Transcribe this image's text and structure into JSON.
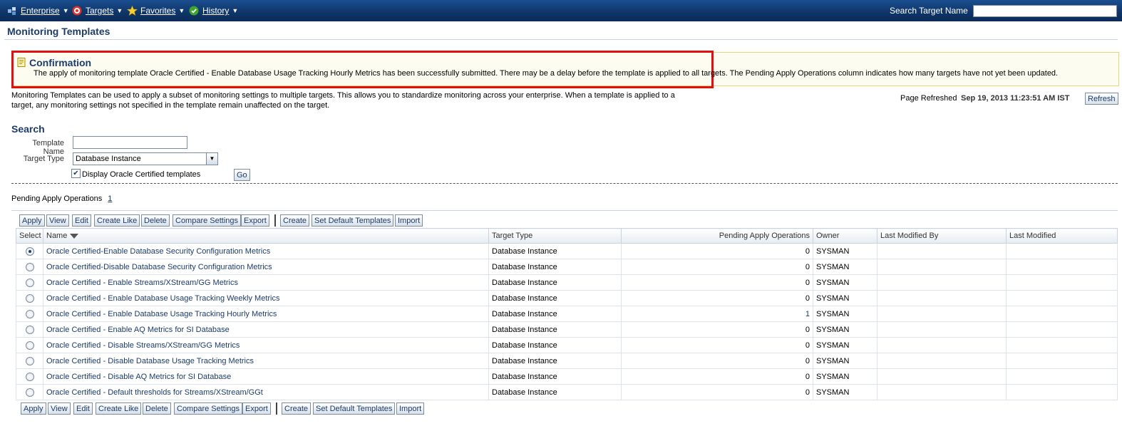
{
  "nav": {
    "enterprise": "Enterprise",
    "targets": "Targets",
    "favorites": "Favorites",
    "history": "History",
    "search_label": "Search Target Name"
  },
  "page": {
    "title": "Monitoring Templates"
  },
  "confirmation": {
    "title": "Confirmation",
    "message": "The apply of monitoring template Oracle Certified - Enable Database Usage Tracking Hourly Metrics has been successfully submitted. There may be a delay before the template is applied to all targets. The Pending Apply Operations column indicates how many targets have not yet been updated."
  },
  "description": "Monitoring Templates can be used to apply a subset of monitoring settings to multiple targets. This allows you to standardize monitoring across your enterprise. When a template is applied to a target, any monitoring settings not specified in the template remain unaffected on the target.",
  "refresh": {
    "label": "Page Refreshed",
    "time": "Sep 19, 2013 11:23:51 AM IST",
    "button": "Refresh"
  },
  "search": {
    "heading": "Search",
    "template_name_label": "Template Name",
    "template_name_value": "",
    "target_type_label": "Target Type",
    "target_type_value": "Database Instance",
    "checkbox_label": "Display Oracle Certified templates",
    "go": "Go"
  },
  "pending": {
    "label": "Pending Apply Operations",
    "count": "1"
  },
  "toolbar": {
    "apply": "Apply",
    "view": "View",
    "edit": "Edit",
    "create_like": "Create Like",
    "delete": "Delete",
    "compare": "Compare Settings",
    "export": "Export",
    "create": "Create",
    "set_default": "Set Default Templates",
    "import": "Import"
  },
  "table": {
    "headers": {
      "select": "Select",
      "name": "Name",
      "target_type": "Target Type",
      "pending": "Pending Apply Operations",
      "owner": "Owner",
      "last_modified_by": "Last Modified By",
      "last_modified": "Last Modified"
    },
    "rows": [
      {
        "name": "Oracle Certified-Enable Database Security Configuration Metrics",
        "type": "Database Instance",
        "pending": "0",
        "owner": "SYSMAN"
      },
      {
        "name": "Oracle Certified-Disable Database Security Configuration Metrics",
        "type": "Database Instance",
        "pending": "0",
        "owner": "SYSMAN"
      },
      {
        "name": "Oracle Certified - Enable Streams/XStream/GG Metrics",
        "type": "Database Instance",
        "pending": "0",
        "owner": "SYSMAN"
      },
      {
        "name": "Oracle Certified - Enable Database Usage Tracking Weekly Metrics",
        "type": "Database Instance",
        "pending": "0",
        "owner": "SYSMAN"
      },
      {
        "name": "Oracle Certified - Enable Database Usage Tracking Hourly Metrics",
        "type": "Database Instance",
        "pending": "1",
        "owner": "SYSMAN"
      },
      {
        "name": "Oracle Certified - Enable AQ Metrics for SI Database",
        "type": "Database Instance",
        "pending": "0",
        "owner": "SYSMAN"
      },
      {
        "name": "Oracle Certified - Disable Streams/XStream/GG Metrics",
        "type": "Database Instance",
        "pending": "0",
        "owner": "SYSMAN"
      },
      {
        "name": "Oracle Certified - Disable Database Usage Tracking Metrics",
        "type": "Database Instance",
        "pending": "0",
        "owner": "SYSMAN"
      },
      {
        "name": "Oracle Certified - Disable AQ Metrics for SI Database",
        "type": "Database Instance",
        "pending": "0",
        "owner": "SYSMAN"
      },
      {
        "name": "Oracle Certified - Default thresholds for Streams/XStream/GGt",
        "type": "Database Instance",
        "pending": "0",
        "owner": "SYSMAN"
      }
    ]
  }
}
